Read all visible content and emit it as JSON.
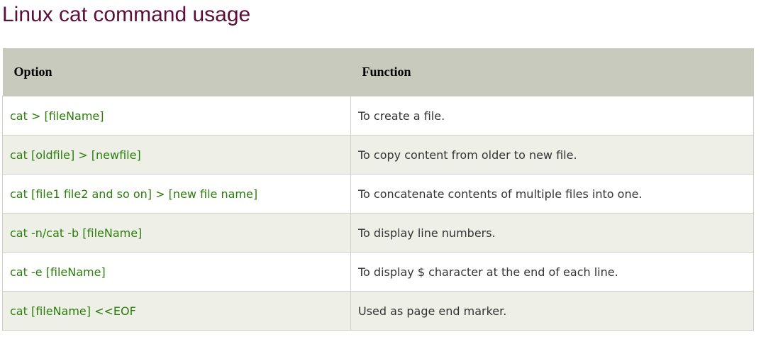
{
  "title": "Linux cat command usage",
  "table": {
    "headers": [
      "Option",
      "Function"
    ],
    "rows": [
      {
        "option": "cat > [fileName]",
        "function": "To create a file."
      },
      {
        "option": "cat [oldfile] > [newfile]",
        "function": "To copy content from older to new file."
      },
      {
        "option": "cat [file1 file2 and so on] > [new file name]",
        "function": "To concatenate contents of multiple files into one."
      },
      {
        "option": "cat -n/cat -b [fileName]",
        "function": "To display line numbers."
      },
      {
        "option": "cat -e [fileName]",
        "function": "To display $ character at the end of each line."
      },
      {
        "option": "cat [fileName] <<EOF",
        "function": "Used as page end marker."
      }
    ]
  }
}
